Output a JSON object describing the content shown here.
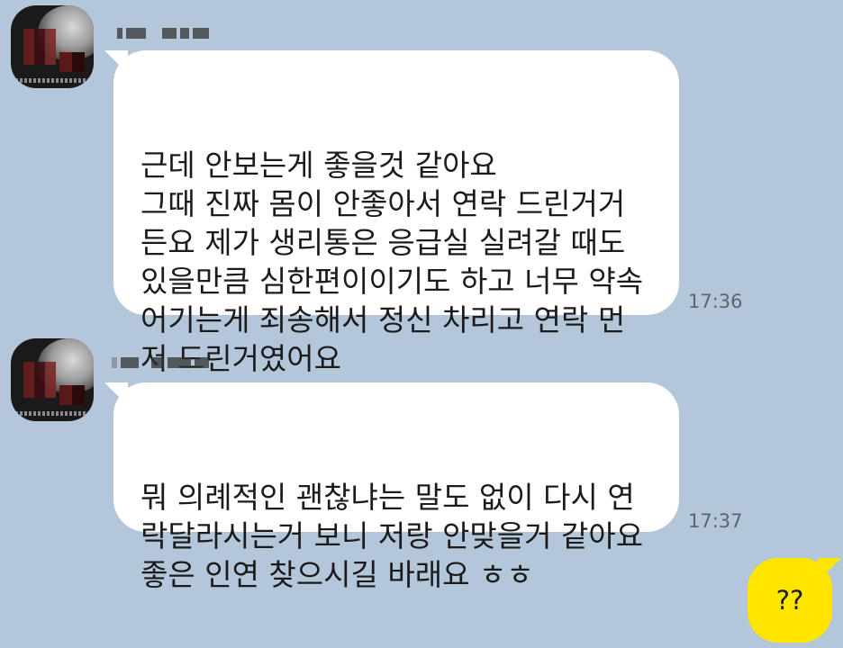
{
  "theme": {
    "background": "#b4c6d9",
    "incoming_bubble": "#ffffff",
    "outgoing_bubble": "#fee500",
    "time_color": "#5c6670"
  },
  "messages": [
    {
      "direction": "incoming",
      "sender_avatar_icon": "profile-photo-pixelated",
      "text": "근데 안보는게 좋을것 같아요\n그때 진짜 몸이 안좋아서 연락 드린거거\n든요 제가 생리통은 응급실 실려갈 때도\n있을만큼 심한편이이기도 하고 너무 약속\n어기는게 죄송해서 정신 차리고 연락 먼\n저 드린거였어요",
      "time": "17:36"
    },
    {
      "direction": "incoming",
      "sender_avatar_icon": "profile-photo-pixelated",
      "text": "뭐 의례적인 괜찮냐는 말도 없이 다시 연\n락달라시는거 보니 저랑 안맞을거 같아요\n좋은 인연 찾으시길 바래요 ㅎㅎ",
      "time": "17:37"
    },
    {
      "direction": "outgoing",
      "text": "??"
    }
  ]
}
